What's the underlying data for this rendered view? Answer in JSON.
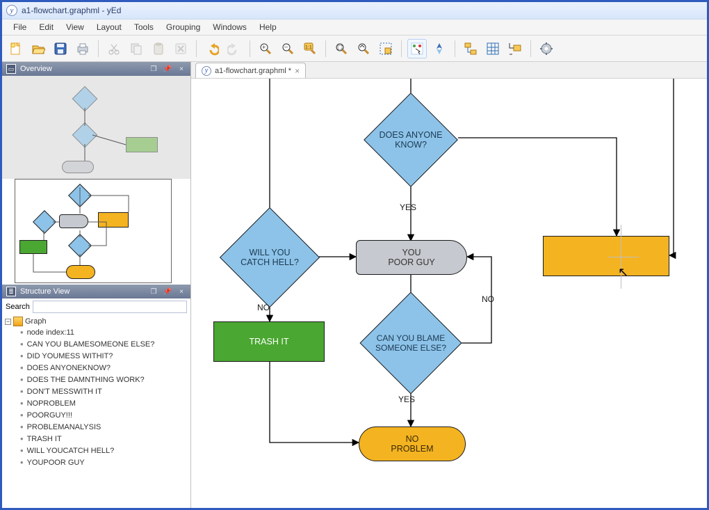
{
  "title": "a1-flowchart.graphml - yEd",
  "menu": {
    "file": "File",
    "edit": "Edit",
    "view": "View",
    "layout": "Layout",
    "tools": "Tools",
    "grouping": "Grouping",
    "windows": "Windows",
    "help": "Help"
  },
  "toolbar": {
    "new": "new",
    "open": "open",
    "save": "save",
    "print": "print",
    "cut": "cut",
    "copy": "copy",
    "paste": "paste",
    "delete": "delete",
    "undo": "undo",
    "redo": "redo",
    "zoomin": "zoom-in",
    "zoomout": "zoom-out",
    "zoom100": "zoom-1:1",
    "zoomsel": "zoom-selection",
    "fit": "fit",
    "area": "area-zoom",
    "select": "selection-mode",
    "nav": "navigation-mode",
    "ortho": "orthogonal",
    "grid": "grid",
    "snap": "snap",
    "settings": "preferences"
  },
  "panels": {
    "overview": {
      "title": "Overview"
    },
    "structure": {
      "title": "Structure View",
      "search_label": "Search",
      "search_value": "",
      "root": "Graph",
      "items": [
        "node index:11",
        "CAN YOU BLAMESOMEONE ELSE?",
        "DID YOUMESS WITHIT?",
        "DOES ANYONEKNOW?",
        "DOES THE DAMNTHING WORK?",
        "DON'T MESSWITH IT",
        "NOPROBLEM",
        "POORGUY!!!",
        "PROBLEMANALYSIS",
        "TRASH IT",
        "WILL YOUCATCH HELL?",
        "YOUPOOR GUY"
      ]
    }
  },
  "tab": {
    "label": "a1-flowchart.graphml *"
  },
  "nodes": {
    "does_anyone_know": "DOES ANYONE\nKNOW?",
    "will_you_catch_hell": "WILL YOU\nCATCH HELL?",
    "you_poor_guy": "YOU\nPOOR GUY",
    "trash_it": "TRASH IT",
    "can_you_blame": "CAN YOU BLAME\nSOMEONE ELSE?",
    "no_problem": "NO\nPROBLEM"
  },
  "edges": {
    "yes1": "YES",
    "no1": "NO",
    "no2": "NO",
    "yes2": "YES"
  }
}
